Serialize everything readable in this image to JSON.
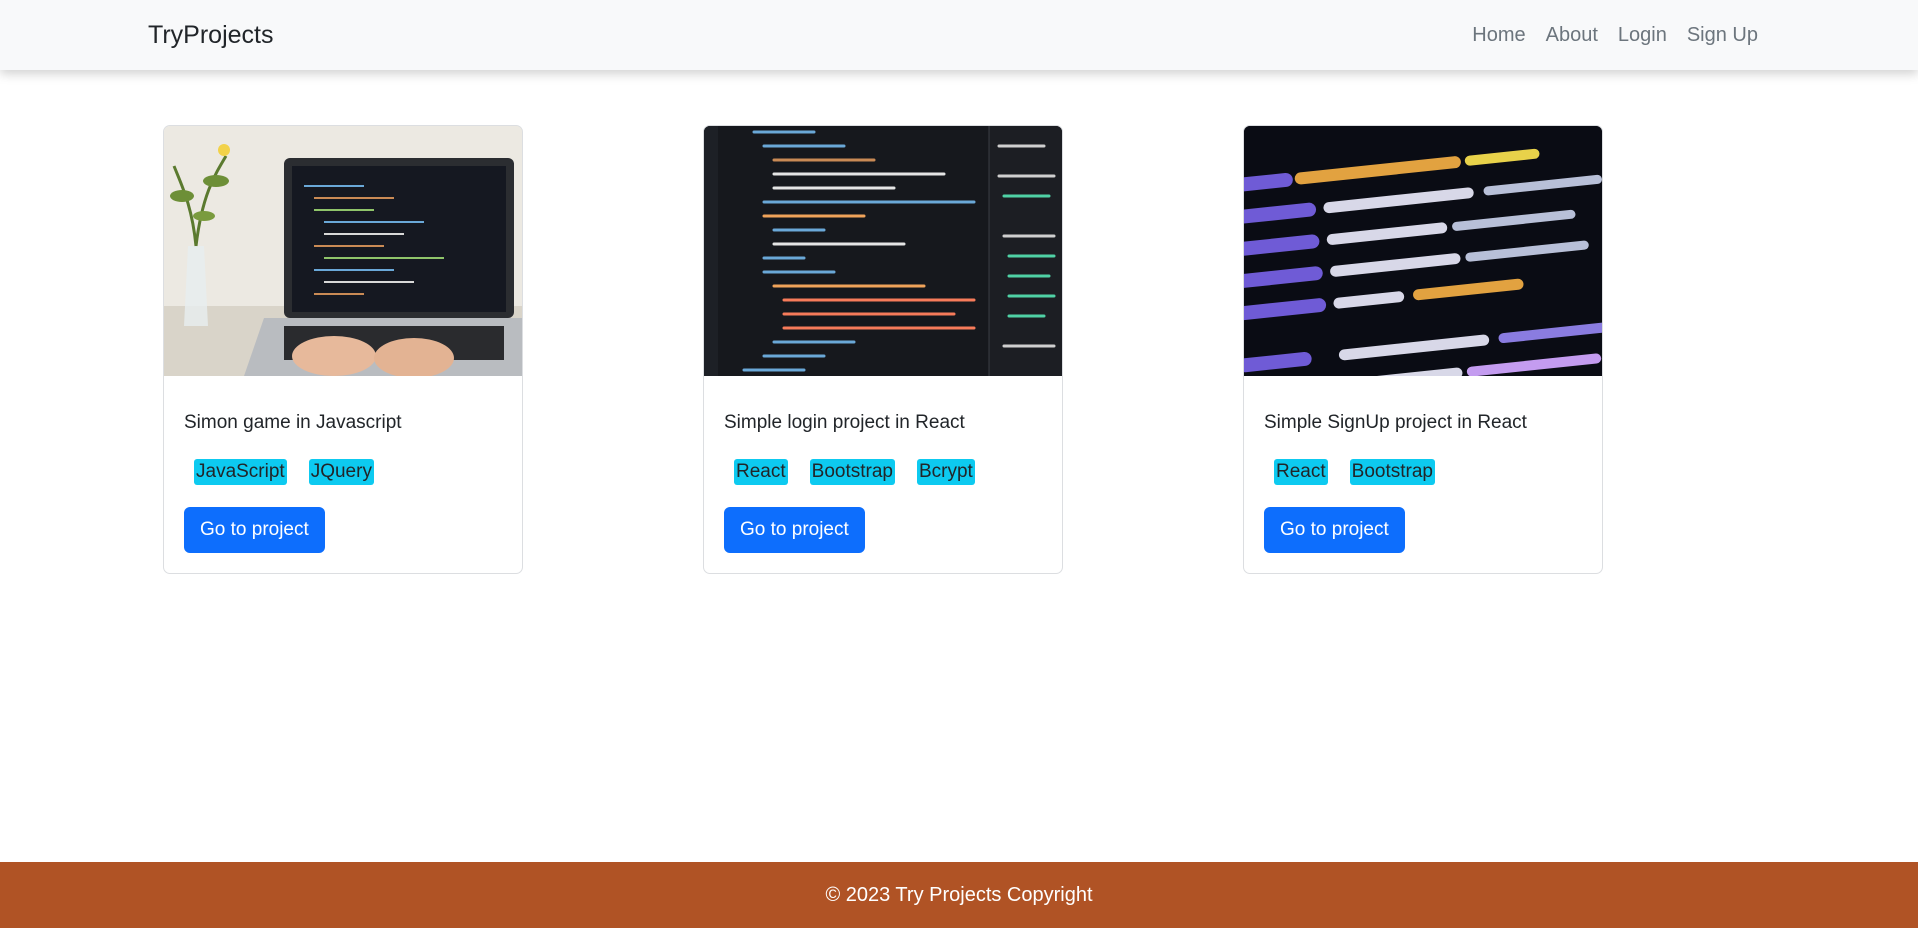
{
  "navbar": {
    "brand": "TryProjects",
    "links": [
      "Home",
      "About",
      "Login",
      "Sign Up"
    ]
  },
  "cards": [
    {
      "title": "Simon game in Javascript",
      "tags": [
        "JavaScript",
        "JQuery"
      ],
      "button": "Go to project",
      "image": "laptop-coding-photo"
    },
    {
      "title": "Simple login project in React",
      "tags": [
        "React",
        "Bootstrap",
        "Bcrypt"
      ],
      "button": "Go to project",
      "image": "html-code-editor-photo"
    },
    {
      "title": "Simple SignUp project in React",
      "tags": [
        "React",
        "Bootstrap"
      ],
      "button": "Go to project",
      "image": "react-code-closeup-photo"
    }
  ],
  "footer": {
    "text": "© 2023 Try Projects Copyright"
  },
  "colors": {
    "navbar_bg": "#f8f9fa",
    "tag_bg": "#0dcaf0",
    "button_bg": "#0d6efd",
    "footer_bg": "#b05325"
  }
}
